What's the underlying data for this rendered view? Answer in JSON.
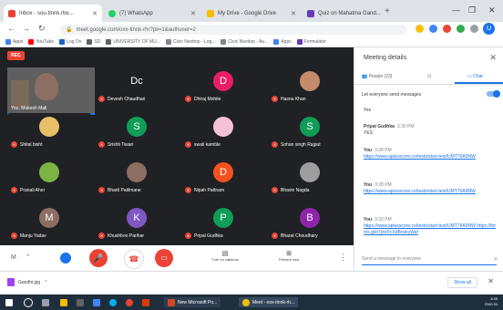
{
  "browser": {
    "tabs": [
      {
        "title": "Inbox - sou-tinnk.rbe..."
      },
      {
        "title": "(7) WhatsApp"
      },
      {
        "title": "My Drive - Google Drive"
      },
      {
        "title": "Quiz on Mahatma Gand..."
      }
    ],
    "url": "meet.google.com/oxx-tinnk-rhr?pli=1&authuser=2",
    "profile_initial": "U"
  },
  "bookmarks": [
    "Apps",
    "YouTube",
    "Log On",
    "SD",
    "UNIVERSITY OF MU...",
    "Civic Nexttop - Log...",
    "Civic Nexttop - Au...",
    "Apps",
    "Formulator"
  ],
  "meeting": {
    "rec_label": "REC",
    "self_name": "You, Mukesh Mali",
    "tiles": [
      {
        "name": "Devesh Chaudhari",
        "initial": "Dc",
        "color": "#202124"
      },
      {
        "name": "Dhiraj Mohite",
        "initial": "D",
        "color": "#e91e63"
      },
      {
        "name": "Hasna Khan",
        "initial": "",
        "color": "#c58b6a"
      },
      {
        "name": "Shital bisht",
        "initial": "",
        "color": "#e8c06a"
      },
      {
        "name": "Srishti Tiwari",
        "initial": "S",
        "color": "#0f9d58"
      },
      {
        "name": "swati kamble",
        "initial": "",
        "color": "#f4c2d7"
      },
      {
        "name": "Sohan singh Rajput",
        "initial": "S",
        "color": "#0f9d58"
      },
      {
        "name": "Pranali Aher",
        "initial": "",
        "color": "#7cb342"
      },
      {
        "name": "Bharti Patilmane",
        "initial": "",
        "color": "#8d6e63"
      },
      {
        "name": "Nipah Pattnam",
        "initial": "D",
        "color": "#f4511e"
      },
      {
        "name": "Bhavin Nagda",
        "initial": "",
        "color": "#9e9e9e"
      },
      {
        "name": "Manju Yadav",
        "initial": "M",
        "color": "#8d6e63"
      },
      {
        "name": "Khushboo Parihar",
        "initial": "K",
        "color": "#7e57c2"
      },
      {
        "name": "Pripal Gudhka",
        "initial": "P",
        "color": "#0f9d58"
      },
      {
        "name": "Bharat Choudhary",
        "initial": "B",
        "color": "#8e24aa"
      }
    ],
    "controls": {
      "captions_label": "Turn on captions",
      "present_label": "Present now"
    }
  },
  "panel": {
    "title": "Meeting details",
    "tabs": {
      "people": "People (23)",
      "chat": "Chat"
    },
    "toggle_label": "Let everyone send messages",
    "messages": [
      {
        "who": "",
        "time": "",
        "text": "Yes",
        "link": ""
      },
      {
        "who": "Pripal Gudhka",
        "time": "3:30 PM",
        "text": "YES",
        "link": ""
      },
      {
        "who": "You",
        "time": "3:28 PM",
        "text": "",
        "link": "https://www.aplusscore.co/tests/start-test/UMT76A9NW"
      },
      {
        "who": "You",
        "time": "3:28 PM",
        "text": "",
        "link": "https://www.aplusscore.co/tests/start-test/UMT76A9NW"
      },
      {
        "who": "You",
        "time": "3:33 PM",
        "text": "",
        "link": "https://www.aplusscore.co/tests/start-test/UMT76A9NW https://forms.gle/7ykrPcXdBnvkyWaf"
      }
    ],
    "send_placeholder": "Send a message to everyone"
  },
  "downloads": {
    "file": "Gandhi.jpg",
    "show_all": "Show all"
  },
  "taskbar": {
    "items": [
      "New Microsoft Po...",
      "Meet - oox-tinnk-rh..."
    ],
    "clock_time": "3:39",
    "clock_lang": "ENG IN"
  }
}
